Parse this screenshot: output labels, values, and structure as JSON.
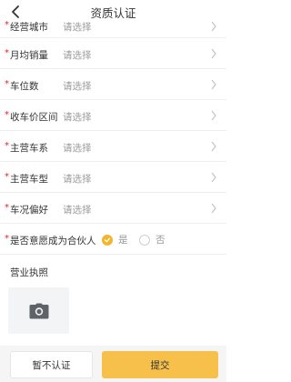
{
  "header": {
    "title": "资质认证"
  },
  "form": {
    "required_mark": "*",
    "fields": [
      {
        "label": "经营城市",
        "value": "请选择"
      },
      {
        "label": "月均销量",
        "value": "请选择"
      },
      {
        "label": "车位数",
        "value": "请选择"
      },
      {
        "label": "收车价区间",
        "value": "请选择"
      },
      {
        "label": "主营车系",
        "value": "请选择"
      },
      {
        "label": "主营车型",
        "value": "请选择"
      },
      {
        "label": "车况偏好",
        "value": "请选择"
      }
    ],
    "partner": {
      "label": "是否意愿成为合伙人",
      "yes_label": "是",
      "no_label": "否",
      "selected": "是"
    }
  },
  "license": {
    "title": "营业执照"
  },
  "footer": {
    "skip_label": "暂不认证",
    "submit_label": "提交"
  },
  "colors": {
    "accent": "#f6c04a",
    "required": "#e0252b",
    "placeholder": "#9a9a9a"
  },
  "icons": {
    "back": "chevron-left-icon",
    "row_arrow": "chevron-right-icon",
    "upload": "camera-icon",
    "selected": "check-icon"
  }
}
